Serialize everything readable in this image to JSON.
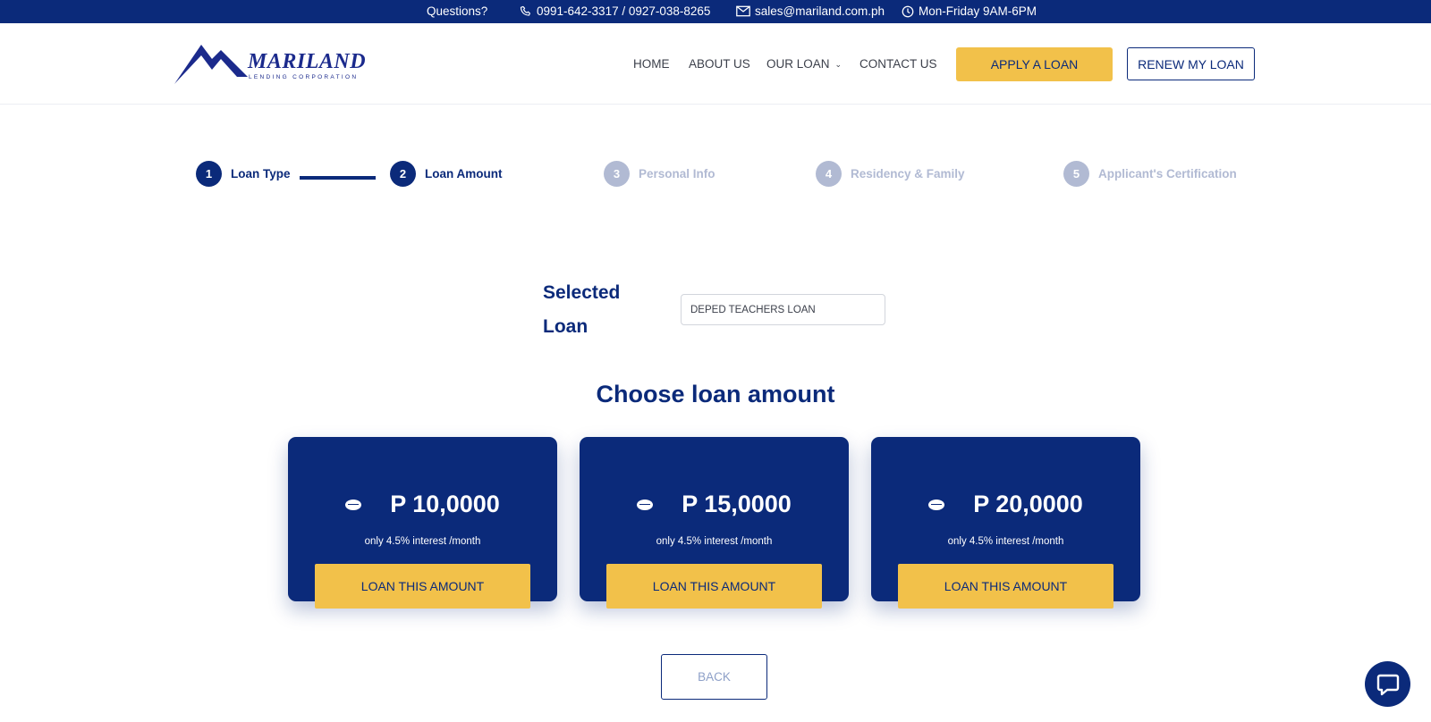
{
  "topbar": {
    "questions": "Questions?",
    "phones": "0991-642-3317 / 0927-038-8265",
    "email": "sales@mariland.com.ph",
    "hours": "Mon-Friday 9AM-6PM"
  },
  "logo": {
    "name": "MARILAND",
    "tagline": "LENDING CORPORATION"
  },
  "nav": {
    "home": "HOME",
    "about": "ABOUT US",
    "our_loan": "OUR LOAN",
    "contact": "CONTACT US",
    "apply": "APPLY A LOAN",
    "renew": "RENEW MY LOAN"
  },
  "steps": [
    {
      "num": "1",
      "label": "Loan Type",
      "state": "active"
    },
    {
      "num": "2",
      "label": "Loan Amount",
      "state": "active"
    },
    {
      "num": "3",
      "label": "Personal Info",
      "state": "inactive"
    },
    {
      "num": "4",
      "label": "Residency & Family",
      "state": "inactive"
    },
    {
      "num": "5",
      "label": "Applicant's Certification",
      "state": "inactive"
    }
  ],
  "selected_loan": {
    "label": "Selected Loan",
    "value": "DEPED TEACHERS LOAN"
  },
  "choose_title": "Choose loan amount",
  "cards": [
    {
      "amount": "P 10,0000",
      "interest": "only 4.5% interest /month",
      "button": "LOAN THIS AMOUNT"
    },
    {
      "amount": "P 15,0000",
      "interest": "only 4.5% interest /month",
      "button": "LOAN THIS AMOUNT"
    },
    {
      "amount": "P 20,0000",
      "interest": "only 4.5% interest /month",
      "button": "LOAN THIS AMOUNT"
    }
  ],
  "back": "BACK",
  "colors": {
    "primary": "#0b2a7a",
    "accent": "#f2c14a",
    "inactive_step": "#b1bad3"
  },
  "icons": [
    "phone-icon",
    "mail-icon",
    "clock-icon",
    "chevron-down-icon",
    "coin-icon",
    "chat-icon"
  ]
}
